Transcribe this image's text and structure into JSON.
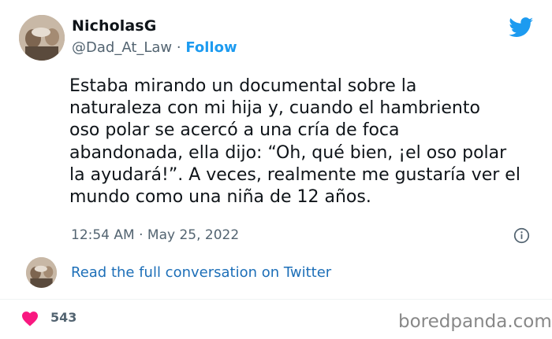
{
  "author": {
    "name": "NicholasG",
    "handle": "@Dad_At_Law",
    "separator": " · ",
    "follow_label": "Follow"
  },
  "tweet": {
    "text": "Estaba mirando un documental sobre la\nnaturaleza con mi hija y, cuando el hambriento\noso polar se acercó a una cría de foca\nabandonada, ella dijo: “Oh, qué bien, ¡el oso polar\nla ayudará!”. A veces, realmente me gustaría ver el\nmundo como una niña de 12 años.",
    "timestamp": "12:54 AM · May 25, 2022"
  },
  "conversation": {
    "link_label": "Read the full conversation on Twitter"
  },
  "engagement": {
    "likes": "543"
  },
  "watermark": "boredpanda.com",
  "icons": {
    "brand": "twitter-bird-icon",
    "info": "info-icon",
    "like": "heart-icon"
  },
  "colors": {
    "twitter_blue": "#1d9bf0",
    "link_blue": "#1d6fb8",
    "heart": "#f91880",
    "secondary_text": "#536471"
  }
}
